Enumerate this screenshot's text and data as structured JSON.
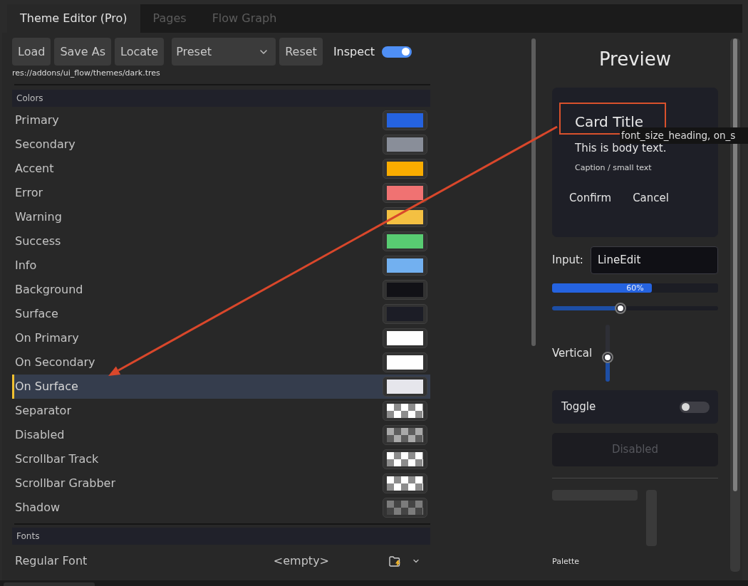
{
  "tabs": [
    {
      "label": "Theme Editor (Pro)",
      "selected": true
    },
    {
      "label": "Pages",
      "selected": false
    },
    {
      "label": "Flow Graph",
      "selected": false
    }
  ],
  "toolbar": [
    {
      "kind": "button",
      "label": "Load"
    },
    {
      "kind": "button",
      "label": "Save As"
    },
    {
      "kind": "button",
      "label": "Locate"
    },
    {
      "kind": "dropdown",
      "value": "Preset"
    },
    {
      "kind": "button",
      "label": "Reset"
    },
    {
      "kind": "toggle",
      "label": "Inspect",
      "on": true
    }
  ],
  "file_path": "res://addons/ui_flow/themes/dark.tres",
  "colors_section": {
    "title": "Colors",
    "items": [
      {
        "label": "Primary",
        "kind": "solid",
        "color": "#2563e0",
        "selected": false
      },
      {
        "label": "Secondary",
        "kind": "solid",
        "color": "#898e99",
        "selected": false
      },
      {
        "label": "Accent",
        "kind": "solid",
        "color": "#f9ac00",
        "selected": false
      },
      {
        "label": "Error",
        "kind": "solid",
        "color": "#f07272",
        "selected": false
      },
      {
        "label": "Warning",
        "kind": "solid",
        "color": "#f4c042",
        "selected": false
      },
      {
        "label": "Success",
        "kind": "solid",
        "color": "#58cc72",
        "selected": false
      },
      {
        "label": "Info",
        "kind": "solid",
        "color": "#72b0f0",
        "selected": false
      },
      {
        "label": "Background",
        "kind": "solid",
        "color": "#111116",
        "selected": false
      },
      {
        "label": "Surface",
        "kind": "solid",
        "color": "#1c1d26",
        "selected": false
      },
      {
        "label": "On Primary",
        "kind": "solid",
        "color": "#ffffff",
        "selected": false
      },
      {
        "label": "On Secondary",
        "kind": "solid",
        "color": "#ffffff",
        "selected": false
      },
      {
        "label": "On Surface",
        "kind": "solid",
        "color": "#e6e6ec",
        "selected": true
      },
      {
        "label": "Separator",
        "kind": "checker",
        "color": "#ffffff",
        "selected": false
      },
      {
        "label": "Disabled",
        "kind": "checker",
        "color": "#a9a9a9",
        "selected": false
      },
      {
        "label": "Scrollbar Track",
        "kind": "checker",
        "color": "#ffffff",
        "selected": false
      },
      {
        "label": "Scrollbar Grabber",
        "kind": "checker",
        "color": "#ffffff",
        "selected": false
      },
      {
        "label": "Shadow",
        "kind": "checker",
        "color": "#7c7c7c",
        "selected": false
      }
    ]
  },
  "fonts_section": {
    "title": "Fonts",
    "items": [
      {
        "label": "Regular Font",
        "value": "<empty>"
      }
    ]
  },
  "preview": {
    "title": "Preview",
    "card": {
      "title": "Card Title",
      "body": "This is body text.",
      "caption": "Caption / small text",
      "buttons": [
        "Confirm",
        "Cancel"
      ]
    },
    "inspect_tooltip": "font_size_heading, on_s",
    "input": {
      "label": "Input:",
      "value": "LineEdit"
    },
    "progress": {
      "level": 0.6,
      "reading": "60%"
    },
    "slider": {
      "level": 0.41
    },
    "vertical_slider": {
      "label": "Vertical",
      "level": 0.42
    },
    "toggle": {
      "label": "Toggle",
      "on": false
    },
    "disabled_button": {
      "label": "Disabled",
      "disabled": true
    },
    "palette_label": "Palette"
  }
}
